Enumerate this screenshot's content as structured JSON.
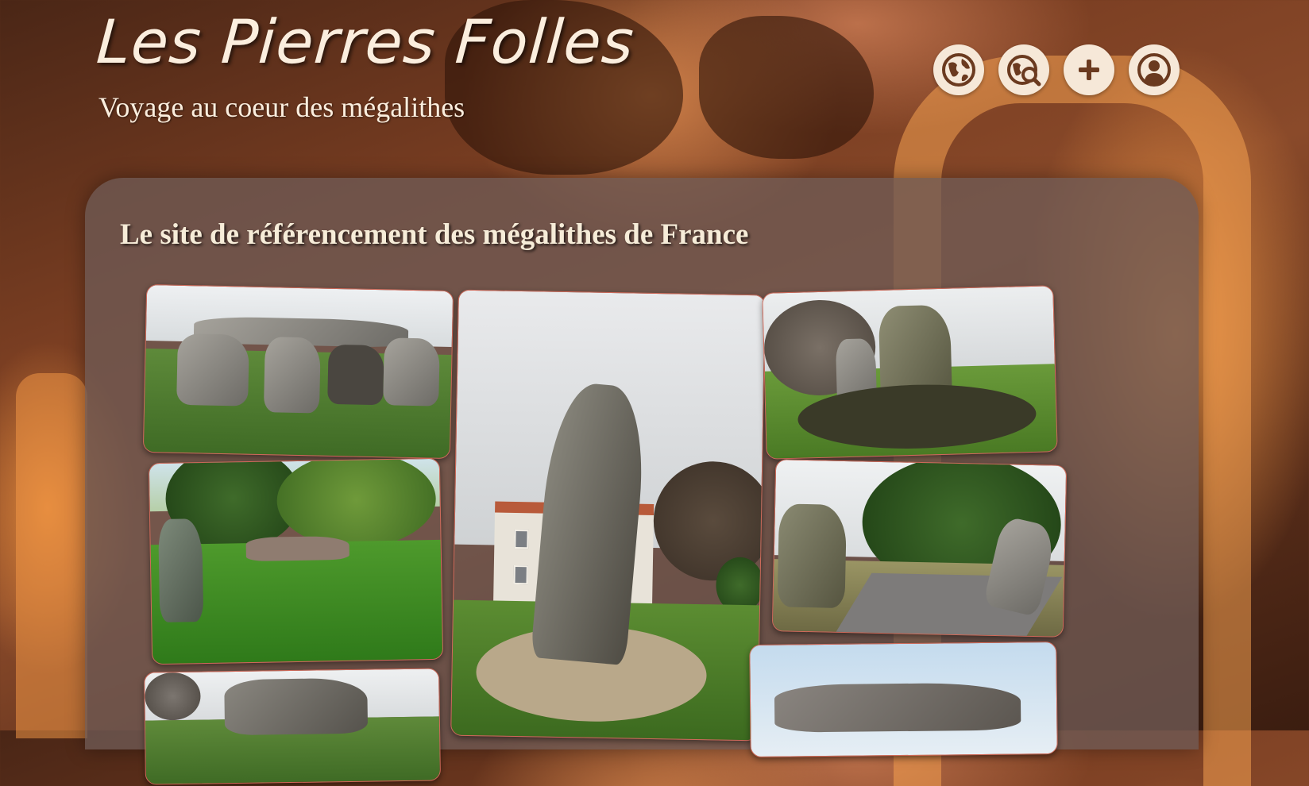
{
  "header": {
    "title": "Les Pierres Folles",
    "subtitle": "Voyage au coeur des mégalithes"
  },
  "nav": {
    "items": [
      {
        "icon": "globe-icon"
      },
      {
        "icon": "map-search-icon"
      },
      {
        "icon": "plus-icon"
      },
      {
        "icon": "user-icon"
      }
    ]
  },
  "main": {
    "heading": "Le site de référencement des mégalithes de France"
  },
  "gallery": {
    "photos": [
      {
        "subject": "dolmen"
      },
      {
        "subject": "menhir"
      },
      {
        "subject": "menhir-field"
      },
      {
        "subject": "grass-stones"
      },
      {
        "subject": "roadside-menhirs"
      },
      {
        "subject": "rocks"
      },
      {
        "subject": "dolmen-sky"
      }
    ]
  },
  "colors": {
    "cream": "#f6e8d8",
    "panel": "#6e5a55",
    "border": "#d06a5a",
    "brown_icon": "#6b3a1f"
  }
}
